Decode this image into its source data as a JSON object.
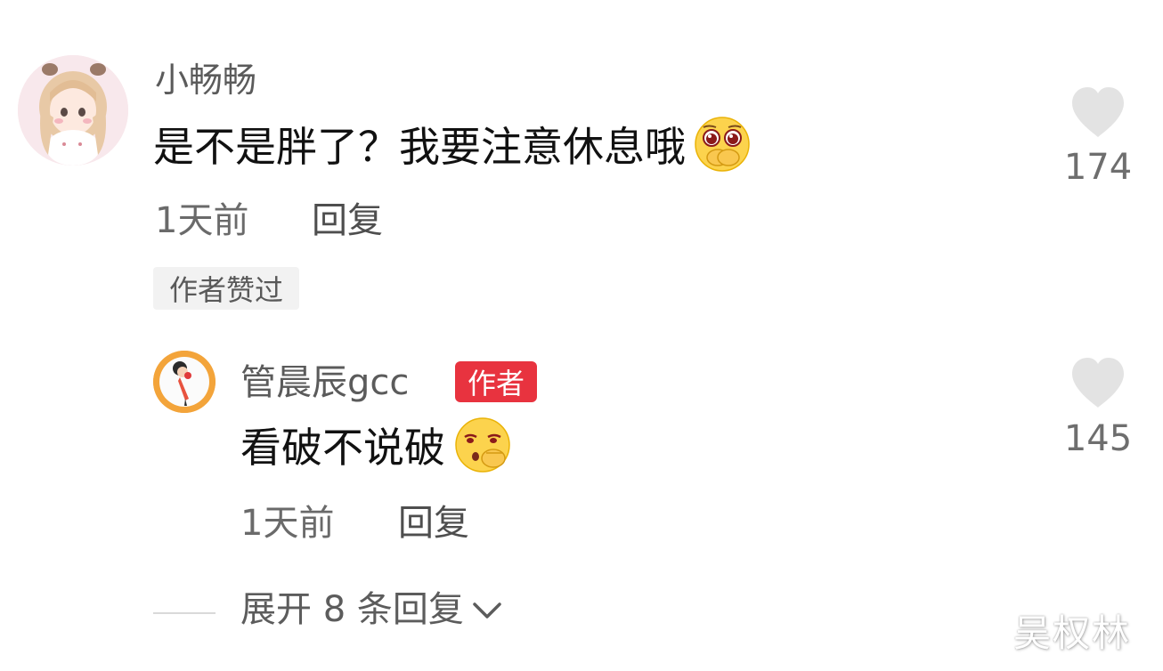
{
  "comment": {
    "username": "小畅畅",
    "text": "是不是胖了？我要注意休息哦",
    "time": "1天前",
    "reply_label": "回复",
    "author_liked": "作者赞过",
    "like_count": "174",
    "emoji_icon": "pleading-face-icon"
  },
  "reply": {
    "username": "管晨辰gcc",
    "badge": "作者",
    "text": "看破不说破",
    "time": "1天前",
    "reply_label": "回复",
    "like_count": "145",
    "emoji_icon": "shushing-face-icon"
  },
  "expand_replies": {
    "label": "展开 8 条回复",
    "icon": "chevron-down-icon"
  },
  "watermark": "吴权林",
  "colors": {
    "badge_red": "#e8333f",
    "heart_gray": "#e3e3e3",
    "text_dark": "#111111",
    "text_gray": "#6a6a6a"
  }
}
